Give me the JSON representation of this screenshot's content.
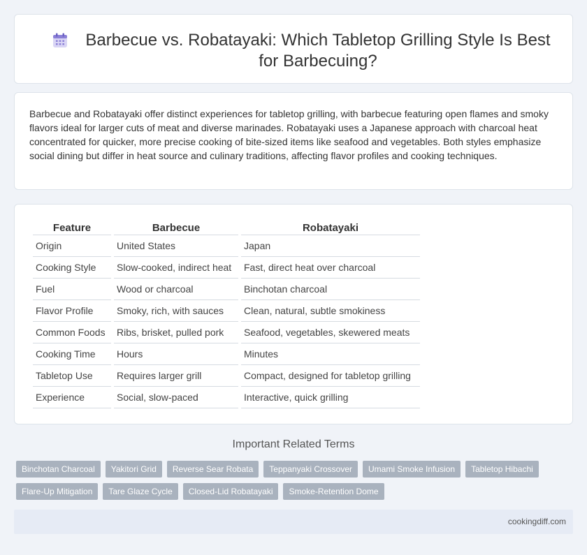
{
  "header": {
    "icon": "calendar-icon",
    "title": "Barbecue vs. Robatayaki: Which Tabletop Grilling Style Is Best for Barbecuing?"
  },
  "summary": {
    "text": "Barbecue and Robatayaki offer distinct experiences for tabletop grilling, with barbecue featuring open flames and smoky flavors ideal for larger cuts of meat and diverse marinades. Robatayaki uses a Japanese approach with charcoal heat concentrated for quicker, more precise cooking of bite-sized items like seafood and vegetables. Both styles emphasize social dining but differ in heat source and culinary traditions, affecting flavor profiles and cooking techniques."
  },
  "table": {
    "headers": [
      "Feature",
      "Barbecue",
      "Robatayaki"
    ],
    "rows": [
      [
        "Origin",
        "United States",
        "Japan"
      ],
      [
        "Cooking Style",
        "Slow-cooked, indirect heat",
        "Fast, direct heat over charcoal"
      ],
      [
        "Fuel",
        "Wood or charcoal",
        "Binchotan charcoal"
      ],
      [
        "Flavor Profile",
        "Smoky, rich, with sauces",
        "Clean, natural, subtle smokiness"
      ],
      [
        "Common Foods",
        "Ribs, brisket, pulled pork",
        "Seafood, vegetables, skewered meats"
      ],
      [
        "Cooking Time",
        "Hours",
        "Minutes"
      ],
      [
        "Tabletop Use",
        "Requires larger grill",
        "Compact, designed for tabletop grilling"
      ],
      [
        "Experience",
        "Social, slow-paced",
        "Interactive, quick grilling"
      ]
    ]
  },
  "related": {
    "title": "Important Related Terms",
    "tags": [
      "Binchotan Charcoal",
      "Yakitori Grid",
      "Reverse Sear Robata",
      "Teppanyaki Crossover",
      "Umami Smoke Infusion",
      "Tabletop Hibachi",
      "Flare-Up Mitigation",
      "Tare Glaze Cycle",
      "Closed-Lid Robatayaki",
      "Smoke-Retention Dome"
    ]
  },
  "footer": {
    "site": "cookingdiff.com"
  },
  "colors": {
    "background": "#f0f3f8",
    "tag": "#a9b2be",
    "footer": "#e6ebf5",
    "icon": "#8a7fd6"
  }
}
